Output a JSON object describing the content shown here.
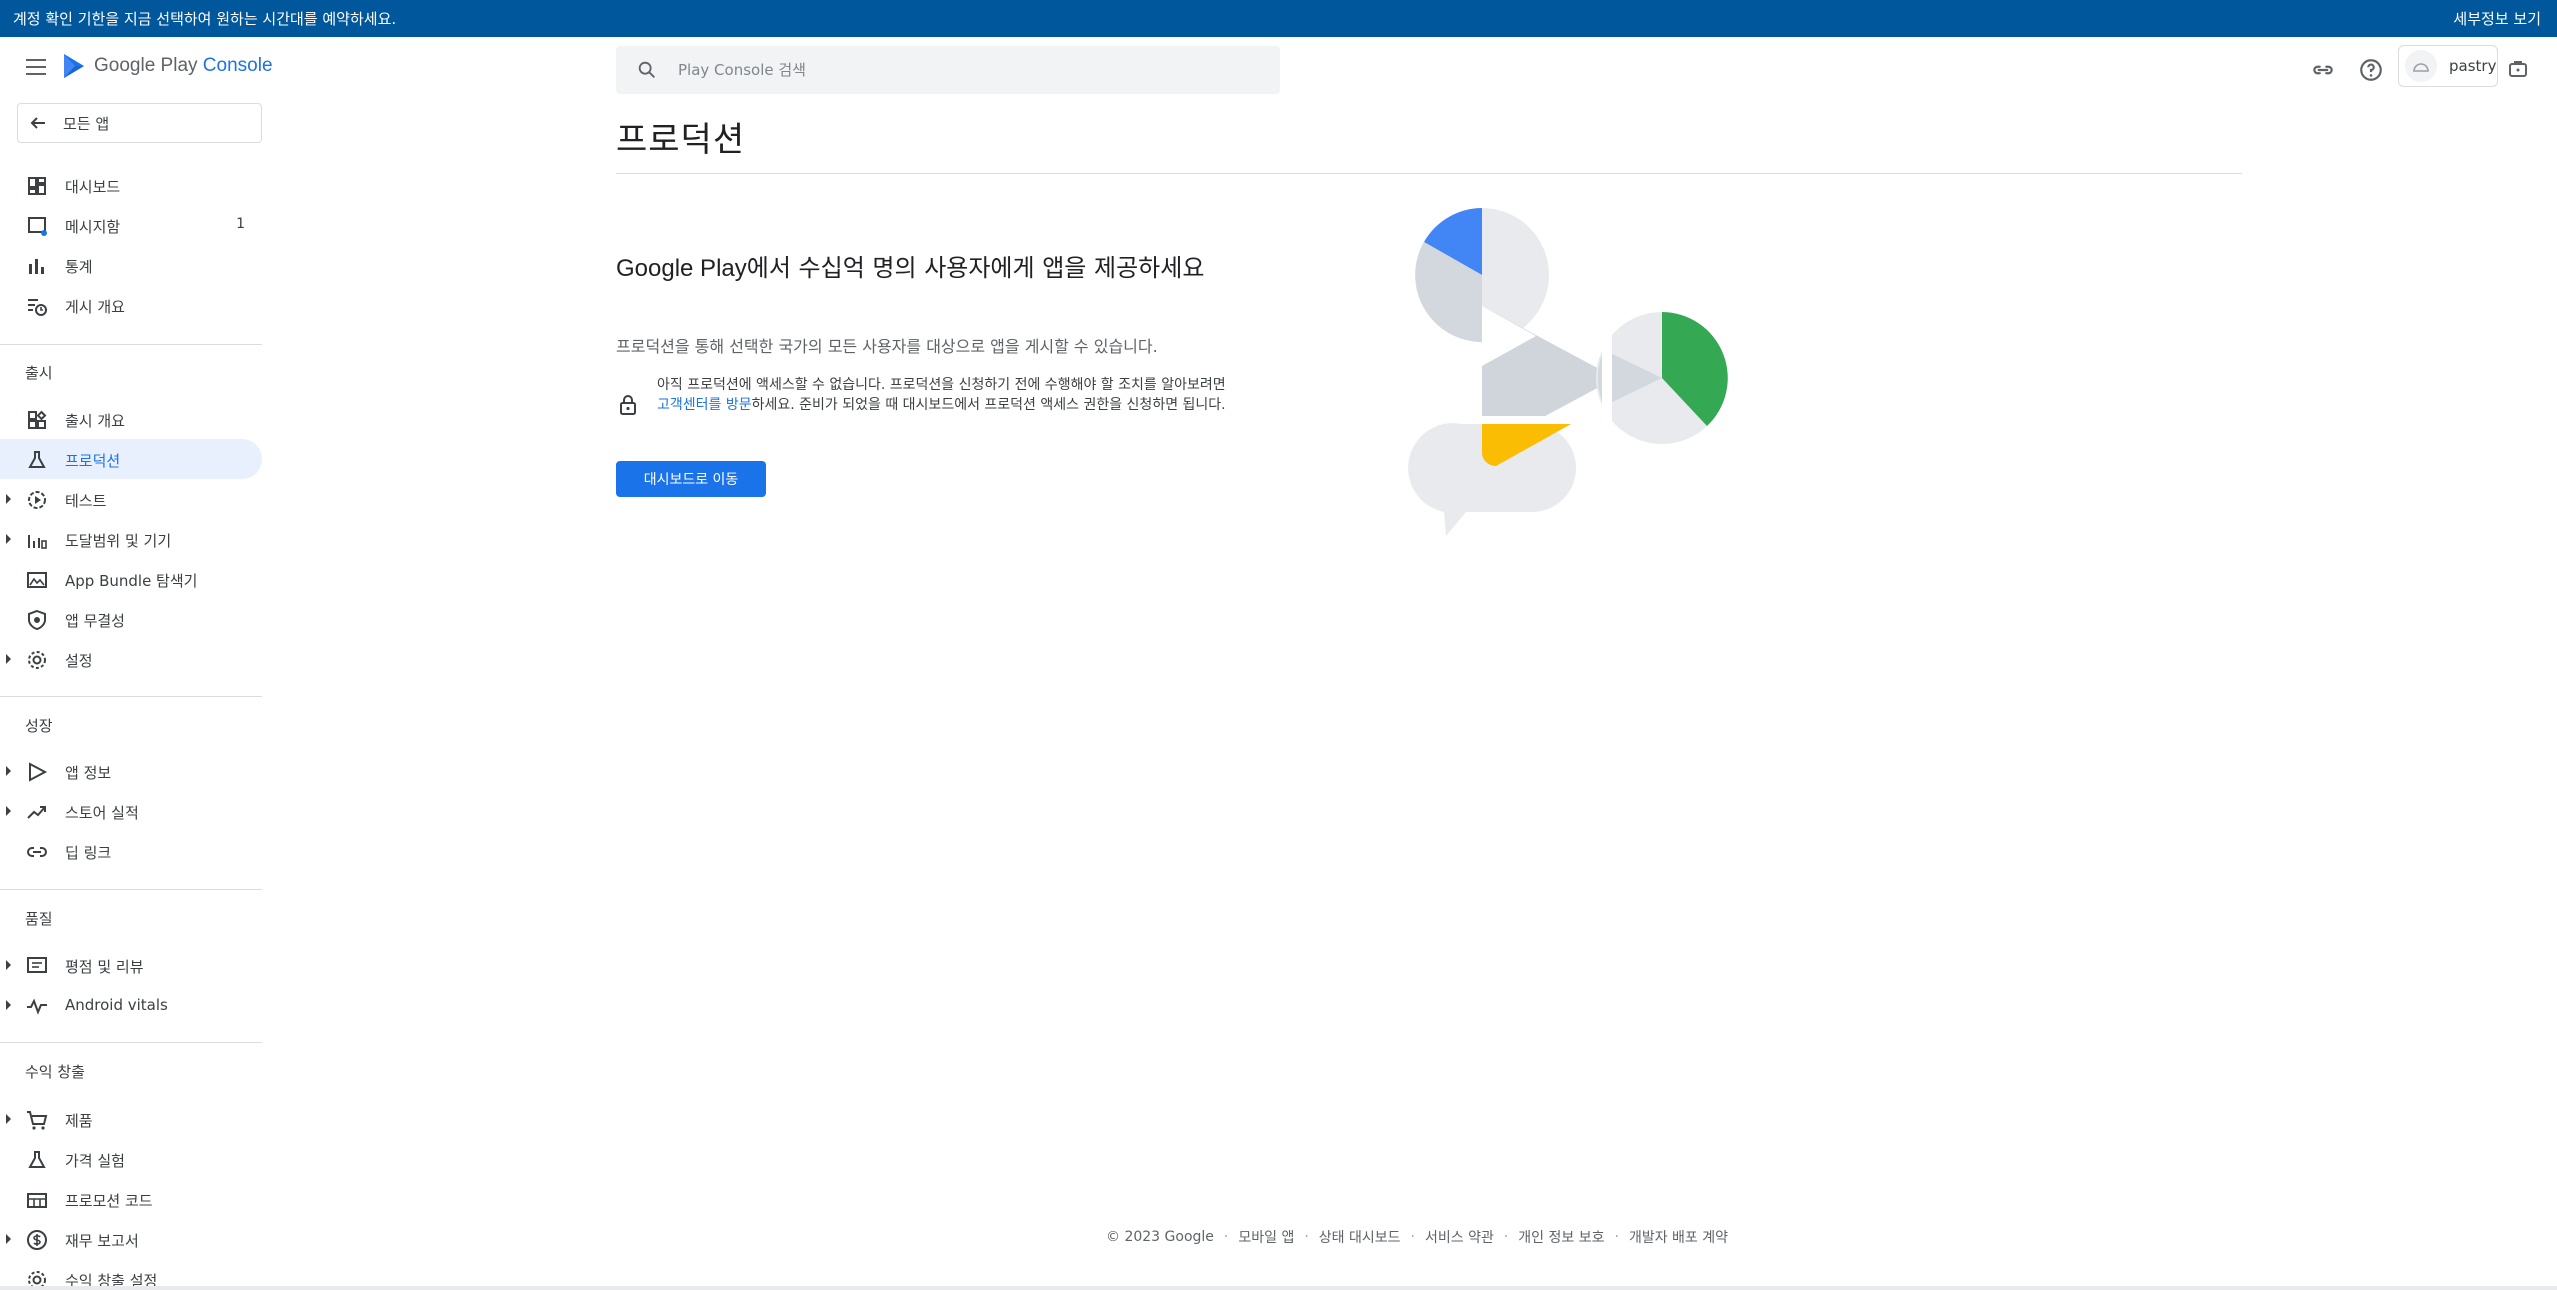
{
  "banner": {
    "message": "계정 확인 기한을 지금 선택하여 원하는 시간대를 예약하세요.",
    "link": "세부정보 보기"
  },
  "header": {
    "logo_brand": "Google Play",
    "logo_product": "Console",
    "search_placeholder": "Play Console 검색",
    "account_name": "pastry"
  },
  "sidebar": {
    "back_label": "모든 앱",
    "items_top": [
      {
        "label": "대시보드",
        "icon": "dashboard-icon"
      },
      {
        "label": "메시지함",
        "icon": "inbox-icon",
        "badge": "1"
      },
      {
        "label": "통계",
        "icon": "bar-chart-icon"
      },
      {
        "label": "게시 개요",
        "icon": "publishing-overview-icon"
      }
    ],
    "section_release": "출시",
    "items_release": [
      {
        "label": "출시 개요",
        "icon": "release-overview-icon"
      },
      {
        "label": "프로덕션",
        "icon": "production-icon"
      },
      {
        "label": "테스트",
        "icon": "testing-icon"
      },
      {
        "label": "도달범위 및 기기",
        "icon": "reach-devices-icon"
      },
      {
        "label": "App Bundle 탐색기",
        "icon": "app-bundle-icon"
      },
      {
        "label": "앱 무결성",
        "icon": "shield-icon"
      },
      {
        "label": "설정",
        "icon": "gear-icon"
      }
    ],
    "section_grow": "성장",
    "items_grow": [
      {
        "label": "앱 정보",
        "icon": "play-icon"
      },
      {
        "label": "스토어 실적",
        "icon": "trending-icon"
      },
      {
        "label": "딥 링크",
        "icon": "link-icon"
      }
    ],
    "section_quality": "품질",
    "items_quality": [
      {
        "label": "평점 및 리뷰",
        "icon": "reviews-icon"
      },
      {
        "label": "Android vitals",
        "icon": "vitals-icon"
      }
    ],
    "section_monetize": "수익 창출",
    "items_monetize": [
      {
        "label": "제품",
        "icon": "cart-icon"
      },
      {
        "label": "가격 실험",
        "icon": "flask-icon"
      },
      {
        "label": "프로모션 코드",
        "icon": "promo-code-icon"
      },
      {
        "label": "재무 보고서",
        "icon": "dollar-icon"
      },
      {
        "label": "수익 창출 설정",
        "icon": "gear-icon"
      }
    ]
  },
  "main": {
    "page_title": "프로덕션",
    "headline_brand": "Google Play",
    "headline_rest": "에서 수십억 명의 사용자에게 앱을 제공하세요",
    "subtext": "프로덕션을 통해 선택한 국가의 모든 사용자를 대상으로 앱을 게시할 수 있습니다.",
    "notice_before": "아직 프로덕션에 액세스할 수 없습니다. 프로덕션을 신청하기 전에 수행해야 할 조치를 알아보려면 ",
    "notice_link": "고객센터를 방문",
    "notice_after": "하세요. 준비가 되었을 때 대시보드에서 프로덕션 액세스 권한을 신청하면 됩니다.",
    "cta_label": "대시보드로 이동"
  },
  "footer": {
    "copyright": "© 2023 Google",
    "links": [
      "모바일 앱",
      "상태 대시보드",
      "서비스 약관",
      "개인 정보 보호",
      "개발자 배포 계약"
    ]
  },
  "colors": {
    "banner_bg": "#01579b",
    "accent": "#1a73e8",
    "illus_blue": "#4285f4",
    "illus_green": "#34a853",
    "illus_yellow": "#fbbc04"
  }
}
